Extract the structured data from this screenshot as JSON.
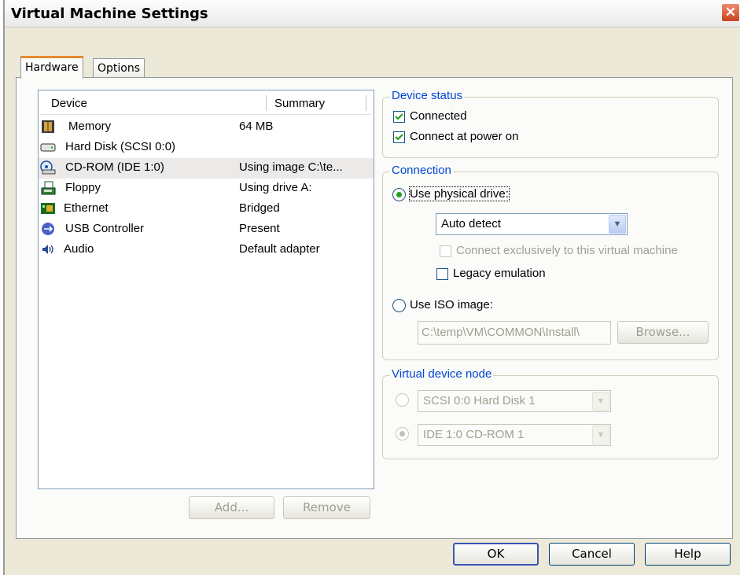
{
  "window": {
    "title": "Virtual Machine Settings",
    "close_glyph": "✕"
  },
  "tabs": [
    {
      "label": "Hardware",
      "active": true
    },
    {
      "label": "Options",
      "active": false
    }
  ],
  "device_list": {
    "columns": [
      "Device",
      "Summary"
    ],
    "rows": [
      {
        "icon": "memory-icon",
        "device": "Memory",
        "summary": "64 MB"
      },
      {
        "icon": "hard-disk-icon",
        "device": "Hard Disk (SCSI 0:0)",
        "summary": ""
      },
      {
        "icon": "cdrom-icon",
        "device": "CD-ROM (IDE 1:0)",
        "summary": "Using image C:\\te...",
        "selected": true
      },
      {
        "icon": "floppy-icon",
        "device": "Floppy",
        "summary": "Using drive A:"
      },
      {
        "icon": "ethernet-icon",
        "device": "Ethernet",
        "summary": "Bridged"
      },
      {
        "icon": "usb-icon",
        "device": "USB Controller",
        "summary": "Present"
      },
      {
        "icon": "audio-icon",
        "device": "Audio",
        "summary": "Default adapter"
      }
    ]
  },
  "list_buttons": {
    "add": "Add...",
    "remove": "Remove"
  },
  "device_status": {
    "title": "Device status",
    "connected": {
      "label": "Connected",
      "checked": true
    },
    "connect_power_on": {
      "label": "Connect at power on",
      "checked": true
    }
  },
  "connection": {
    "title": "Connection",
    "use_physical": {
      "label": "Use physical drive:",
      "selected": true
    },
    "drive_select": "Auto detect",
    "connect_exclusive": {
      "label": "Connect exclusively to this virtual machine",
      "checked": false,
      "enabled": false
    },
    "legacy": {
      "label": "Legacy emulation",
      "checked": false
    },
    "use_iso": {
      "label": "Use ISO image:",
      "selected": false
    },
    "iso_path": "C:\\temp\\VM\\COMMON\\Install\\",
    "browse": "Browse..."
  },
  "virtual_node": {
    "title": "Virtual device node",
    "scsi": "SCSI 0:0  Hard Disk 1",
    "ide": "IDE 1:0  CD-ROM 1"
  },
  "footer": {
    "ok": "OK",
    "cancel": "Cancel",
    "help": "Help"
  },
  "colors": {
    "accent": "#0046d5",
    "check": "#21a121",
    "tab_highlight": "#e68b2c"
  }
}
